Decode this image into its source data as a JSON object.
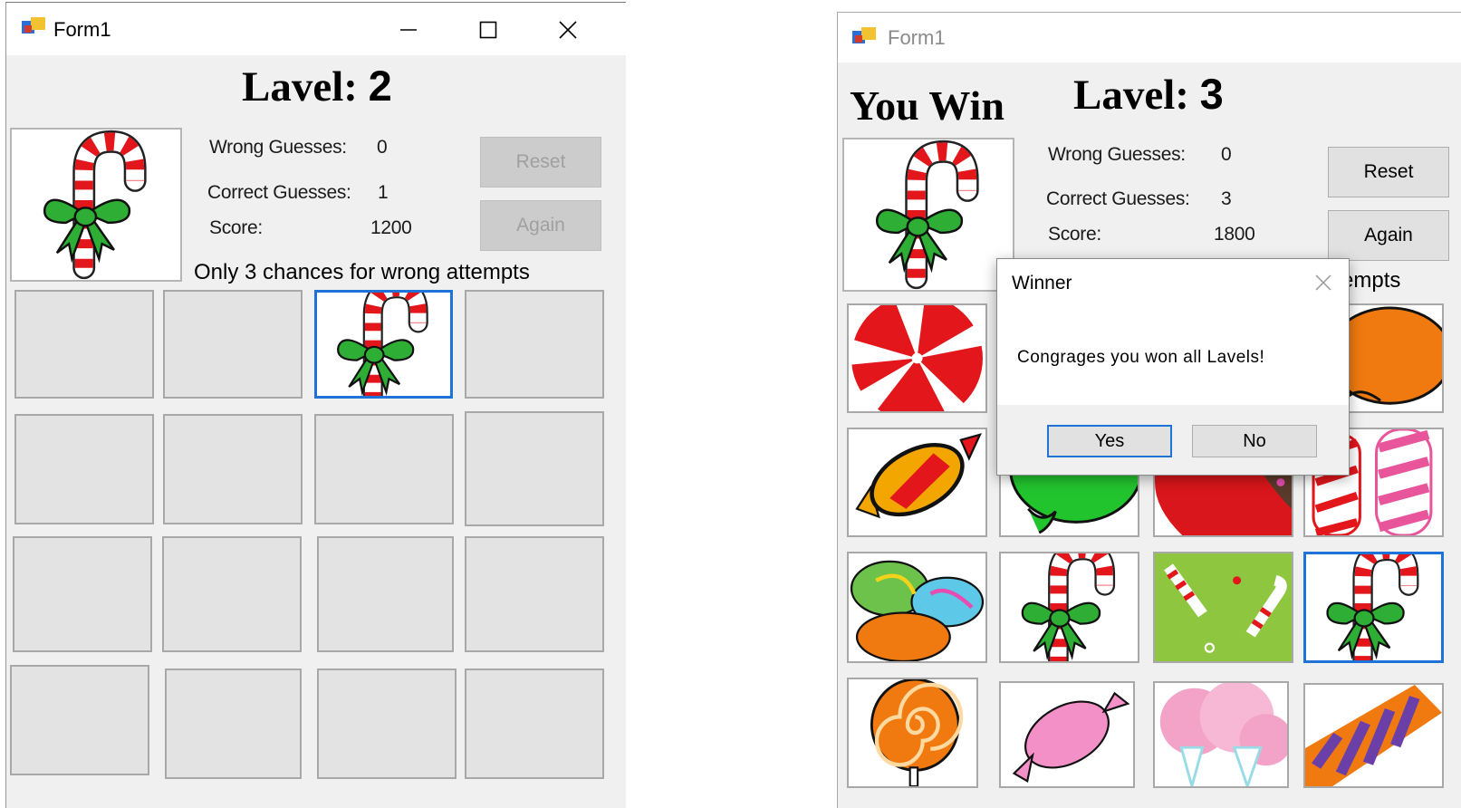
{
  "left_window": {
    "title": "Form1",
    "level_label": "Lavel:",
    "level_value": "2",
    "stats": {
      "wrong_label": "Wrong Guesses:",
      "wrong_value": "0",
      "correct_label": "Correct Guesses:",
      "correct_value": "1",
      "score_label": "Score:",
      "score_value": "1200"
    },
    "reset_label": "Reset",
    "again_label": "Again",
    "message": "Only 3 chances for wrong attempts",
    "preview_icon": "candy-cane-icon",
    "tiles": [
      "hidden",
      "hidden",
      "candy-cane",
      "hidden",
      "hidden",
      "hidden",
      "hidden",
      "hidden",
      "hidden",
      "hidden",
      "hidden",
      "hidden",
      "hidden",
      "hidden",
      "hidden",
      "hidden"
    ]
  },
  "right_window": {
    "title": "Form1",
    "win_text": "You Win",
    "level_label": "Lavel:",
    "level_value": "3",
    "stats": {
      "wrong_label": "Wrong Guesses:",
      "wrong_value": "0",
      "correct_label": "Correct Guesses:",
      "correct_value": "3",
      "score_label": "Score:",
      "score_value": "1800"
    },
    "reset_label": "Reset",
    "again_label": "Again",
    "message_partial": "empts",
    "preview_icon": "candy-cane-icon",
    "tiles": [
      "peppermint",
      "hidden",
      "hidden",
      "orange-candy",
      "wrapped-candy",
      "green-candy",
      "red-candy",
      "striped-candy",
      "candy-pile",
      "candy-cane",
      "candy-cane-pattern",
      "candy-cane",
      "lollipop",
      "pink-candy",
      "cotton-candy",
      "purple-stripe-candy"
    ]
  },
  "dialog": {
    "title": "Winner",
    "message": "Congrages you won all Lavels!",
    "yes_label": "Yes",
    "no_label": "No"
  },
  "colors": {
    "selection_border": "#1e73d8",
    "form_background": "#f0f0f0"
  }
}
